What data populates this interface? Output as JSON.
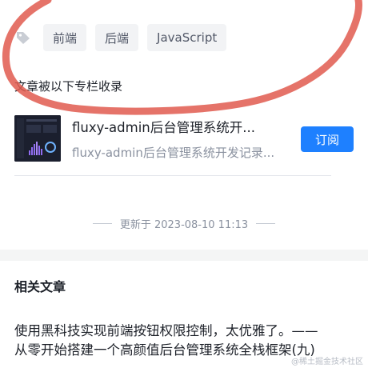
{
  "tags": {
    "icon": "tag-icon",
    "items": [
      "前端",
      "后端",
      "JavaScript"
    ]
  },
  "column_section": {
    "heading": "文章被以下专栏收录",
    "title": "fluxy-admin后台管理系统开...",
    "subtitle": "fluxy-admin后台管理系统开发记录...",
    "subscribe_label": "订阅"
  },
  "update": {
    "text": "更新于 2023-08-10 11:13"
  },
  "related": {
    "heading": "相关文章",
    "article_line1": "使用黑科技实现前端按钮权限控制，太优雅了。——",
    "article_line2": "从零开始搭建一个高颜值后台管理系统全栈框架(九)"
  },
  "watermark": "@稀土掘金技术社区",
  "colors": {
    "accent": "#1e80ff",
    "annotation_stroke": "#e05a4f"
  }
}
